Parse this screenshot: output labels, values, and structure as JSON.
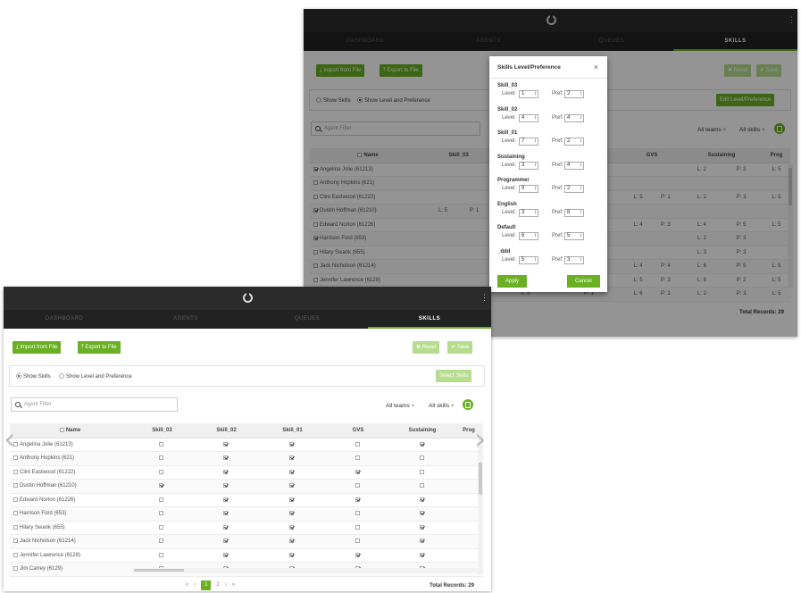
{
  "nav": {
    "tabs": [
      "DASHBOARD",
      "AGENTS",
      "QUEUES",
      "SKILLS"
    ],
    "active": "SKILLS"
  },
  "toolbar": {
    "import_label": "Import from File",
    "export_label": "Export to File",
    "reset_label": "Reset",
    "save_label": "Save"
  },
  "mode": {
    "show_skills": "Show Skills",
    "show_level": "Show Level and Preference"
  },
  "edit_btn": "Edit Level/Preference",
  "select_btn": "Select Skills",
  "search": {
    "placeholder": "Agent Filter"
  },
  "filters": {
    "teams": "All teams",
    "skills": "All skills"
  },
  "pagination": {
    "first": "«",
    "prev": "‹",
    "page1": "1",
    "page2": "2",
    "next": "›",
    "last": "»",
    "total": "Total Records: 29"
  },
  "modal": {
    "title": "Skills Level/Preference",
    "close": "×",
    "level_label": "Level:",
    "pref_label": "Pref:",
    "skills": [
      {
        "name": "Skill_03",
        "level": "1",
        "pref": "2"
      },
      {
        "name": "Skill_02",
        "level": "4",
        "pref": "4"
      },
      {
        "name": "Skill_01",
        "level": "7",
        "pref": "2"
      },
      {
        "name": "Sustaining",
        "level": "3",
        "pref": "4"
      },
      {
        "name": "Programmer",
        "level": "9",
        "pref": "2"
      },
      {
        "name": "English",
        "level": "3",
        "pref": "8"
      },
      {
        "name": "Default",
        "level": "6",
        "pref": "5"
      },
      {
        "name": "_ddd",
        "level": "5",
        "pref": "3"
      }
    ],
    "apply": "Apply",
    "cancel": "Cancel"
  },
  "back_table": {
    "columns": [
      "Name",
      "Skill_03",
      "",
      "GVS",
      "Sustaining",
      "Prog"
    ],
    "rows": [
      {
        "name": "Angelina Jolie (61213)",
        "checked": true,
        "s03": [
          "",
          ""
        ],
        "mid": [
          "",
          "P: 1"
        ],
        "gvs": [
          "",
          ""
        ],
        "sus": [
          "L: 2",
          "P: 3"
        ],
        "prog": "L: 5"
      },
      {
        "name": "Anthony Hopkins (621)",
        "checked": false,
        "s03": [
          "",
          ""
        ],
        "mid": [
          "",
          "P: 4"
        ],
        "gvs": [
          "",
          ""
        ],
        "sus": [
          "",
          ""
        ],
        "prog": ""
      },
      {
        "name": "Clint Eastwood (61222)",
        "checked": false,
        "s03": [
          "",
          ""
        ],
        "mid": [
          "",
          "P: 2"
        ],
        "gvs": [
          "L: 5",
          "P: 1"
        ],
        "sus": [
          "L: 2",
          "P: 3"
        ],
        "prog": "L: 5"
      },
      {
        "name": "Dustin Hoffman (61210)",
        "checked": true,
        "s03": [
          "L: 5",
          "P: 1"
        ],
        "mid": [
          "",
          "P: 2"
        ],
        "gvs": [
          "",
          ""
        ],
        "sus": [
          "",
          ""
        ],
        "prog": ""
      },
      {
        "name": "Edward Norton (61226)",
        "checked": false,
        "s03": [
          "",
          ""
        ],
        "mid": [
          "",
          "P: 4"
        ],
        "gvs": [
          "L: 4",
          "P: 3"
        ],
        "sus": [
          "L: 4",
          "P: 5"
        ],
        "prog": "L: 5"
      },
      {
        "name": "Harrison Ford (653)",
        "checked": true,
        "s03": [
          "",
          ""
        ],
        "mid": [
          "",
          "P: 3"
        ],
        "gvs": [
          "",
          ""
        ],
        "sus": [
          "L: 2",
          "P: 3"
        ],
        "prog": ""
      },
      {
        "name": "Hilary Swank (655)",
        "checked": false,
        "s03": [
          "",
          ""
        ],
        "mid": [
          "",
          "P: 2"
        ],
        "gvs": [
          "",
          ""
        ],
        "sus": [
          "L: 3",
          "P: 3"
        ],
        "prog": ""
      },
      {
        "name": "Jack Nicholson (61214)",
        "checked": false,
        "s03": [
          "",
          ""
        ],
        "mid": [
          "",
          "P: 4"
        ],
        "gvs": [
          "L: 4",
          "P: 4"
        ],
        "sus": [
          "L: 6",
          "P: 5"
        ],
        "prog": "L: 5"
      },
      {
        "name": "Jennifer Lawrence (6128)",
        "checked": false,
        "s03": [
          "",
          ""
        ],
        "mid": [
          "",
          "P: 3"
        ],
        "gvs": [
          "L: 5",
          "P: 3"
        ],
        "sus": [
          "L: 8",
          "P: 2"
        ],
        "prog": "L: 5"
      }
    ],
    "last_row": {
      "s03": [
        "L: 5",
        "P: 1"
      ],
      "mid": [
        "L: 5",
        "P: 1"
      ],
      "gvs": [
        "L: 6",
        "P: 1"
      ],
      "sus": [
        "L: 2",
        "P: 3"
      ],
      "prog": "L: 5"
    }
  },
  "front_table": {
    "columns": [
      "Name",
      "Skill_03",
      "Skill_02",
      "Skill_01",
      "GVS",
      "Sustaining",
      "Prog"
    ],
    "rows": [
      {
        "name": "Angelina Jolie (61213)",
        "cells": [
          false,
          true,
          true,
          false,
          true
        ]
      },
      {
        "name": "Anthony Hopkins (621)",
        "cells": [
          false,
          true,
          true,
          false,
          false
        ]
      },
      {
        "name": "Clint Eastwood (61222)",
        "cells": [
          false,
          true,
          true,
          true,
          false
        ]
      },
      {
        "name": "Dustin Hoffman (61210)",
        "cells": [
          true,
          true,
          true,
          false,
          false
        ]
      },
      {
        "name": "Edward Norton (61226)",
        "cells": [
          false,
          true,
          true,
          true,
          true
        ]
      },
      {
        "name": "Harrison Ford (653)",
        "cells": [
          false,
          true,
          true,
          false,
          true
        ]
      },
      {
        "name": "Hilary Swank (655)",
        "cells": [
          false,
          true,
          true,
          false,
          true
        ]
      },
      {
        "name": "Jack Nicholson (61214)",
        "cells": [
          false,
          true,
          true,
          false,
          true
        ]
      },
      {
        "name": "Jennifer Lawrence (6128)",
        "cells": [
          false,
          true,
          true,
          true,
          true
        ]
      },
      {
        "name": "Jim Carrey (6129)",
        "cells": [
          false,
          true,
          true,
          true,
          true
        ]
      }
    ]
  },
  "colors": {
    "accent": "#6ab023",
    "topbar": "#2b2b2b",
    "navbar": "#222222"
  },
  "icons": {
    "prev_slide": "chevron-left-icon",
    "next_slide": "chevron-right-icon"
  }
}
